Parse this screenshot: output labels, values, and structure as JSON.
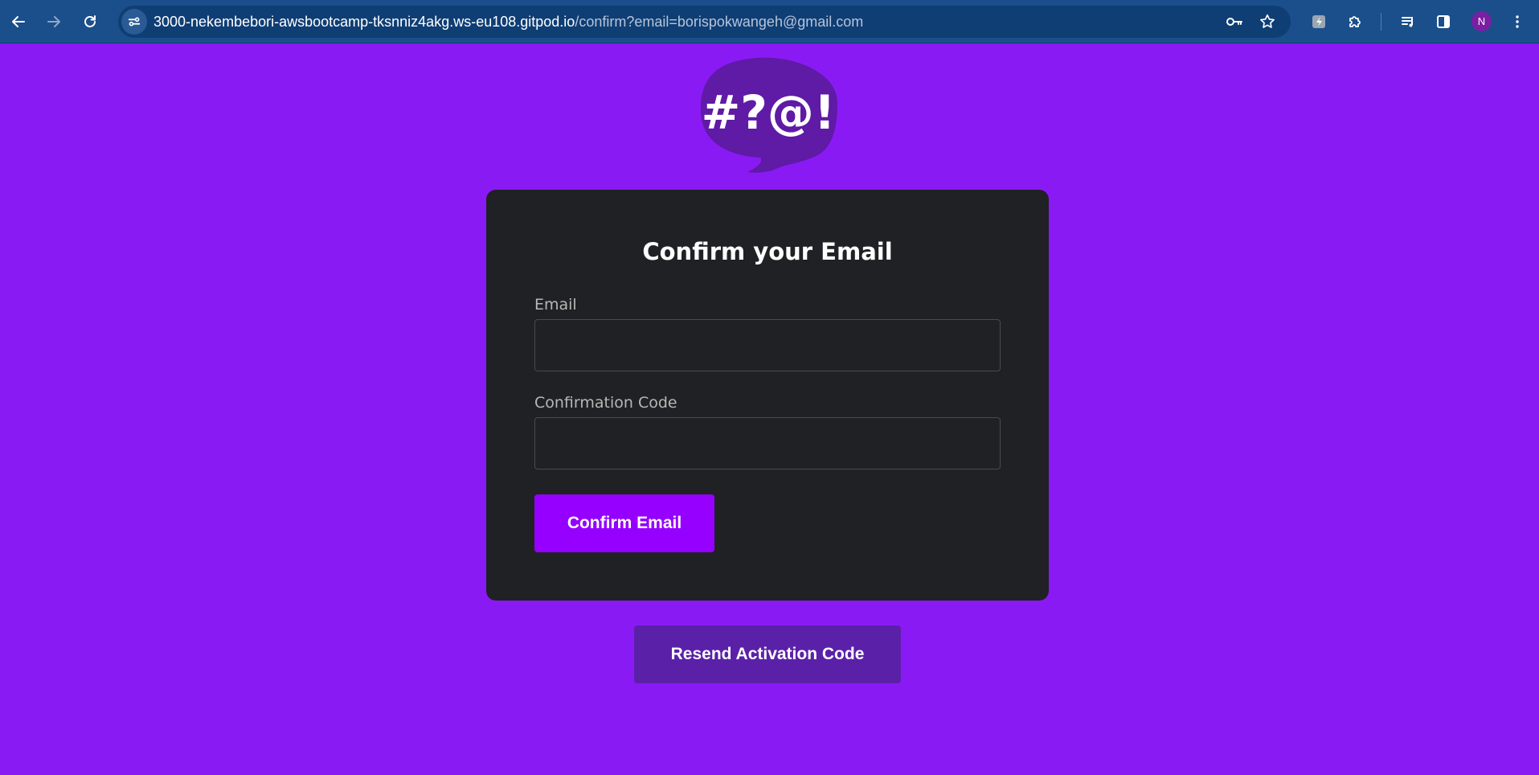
{
  "browser": {
    "url_host": "3000-nekembebori-awsbootcamp-tksnniz4akg.ws-eu108.gitpod.io",
    "url_path": "/confirm?email=borispokwangeh@gmail.com",
    "profile_initial": "N",
    "icons": [
      "back-icon",
      "forward-icon",
      "reload-icon",
      "site-info-icon",
      "key-icon",
      "star-icon",
      "extension-app-icon",
      "puzzle-icon",
      "media-icon",
      "side-panel-icon",
      "menu-icon"
    ]
  },
  "logo": {
    "text": "#?@!"
  },
  "form": {
    "title": "Confirm your Email",
    "email_label": "Email",
    "email_value": "",
    "code_label": "Confirmation Code",
    "code_value": "",
    "submit_label": "Confirm Email"
  },
  "resend_label": "Resend Activation Code",
  "colors": {
    "page_background": "#8a1af4",
    "card_background": "#202124",
    "primary_button": "#9500ff",
    "secondary_button": "#5a21a8",
    "logo_bubble": "#5f1aa6",
    "toolbar": "#1a4f8b"
  }
}
